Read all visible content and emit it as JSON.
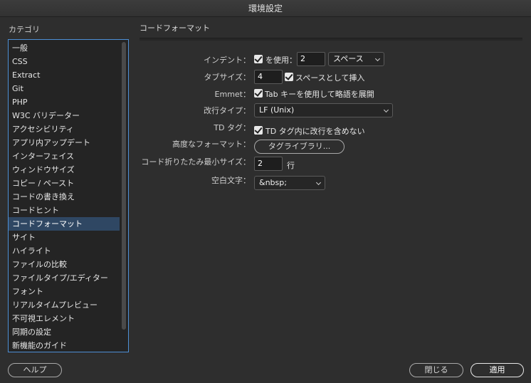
{
  "window": {
    "title": "環境設定"
  },
  "sidebar": {
    "label": "カテゴリ",
    "items": [
      "一般",
      "CSS",
      "Extract",
      "Git",
      "PHP",
      "W3C バリデーター",
      "アクセシビリティ",
      "アプリ内アップデート",
      "インターフェイス",
      "ウィンドウサイズ",
      "コピー / ペースト",
      "コードの書き換え",
      "コードヒント",
      "コードフォーマット",
      "サイト",
      "ハイライト",
      "ファイルの比較",
      "ファイルタイプ/エディター",
      "フォント",
      "リアルタイムプレビュー",
      "不可視エレメント",
      "同期の設定",
      "新機能のガイド"
    ],
    "selected_index": 13
  },
  "panel": {
    "title": "コードフォーマット",
    "indent": {
      "label": "インデント：",
      "use_label": "を使用：",
      "use_checked": true,
      "value": "2",
      "unit": "スペース"
    },
    "tab_size": {
      "label": "タブサイズ：",
      "value": "4",
      "spaces_label": "スペースとして挿入",
      "spaces_checked": true
    },
    "emmet": {
      "label": "Emmet：",
      "option_label": "Tab キーを使用して略語を展開",
      "checked": true
    },
    "line_break": {
      "label": "改行タイプ：",
      "value": "LF (Unix)"
    },
    "td_tag": {
      "label": "TD タグ：",
      "option_label": "TD タグ内に改行を含めない",
      "checked": true
    },
    "advanced": {
      "label": "高度なフォーマット：",
      "button_label": "タグライブラリ..."
    },
    "wrap": {
      "label": "コード折りたたみ最小サイズ：",
      "value": "2",
      "unit": "行"
    },
    "whitespace": {
      "label": "空白文字：",
      "value": "&nbsp;"
    }
  },
  "footer": {
    "help_label": "ヘルプ",
    "close_label": "閉じる",
    "apply_label": "適用"
  }
}
